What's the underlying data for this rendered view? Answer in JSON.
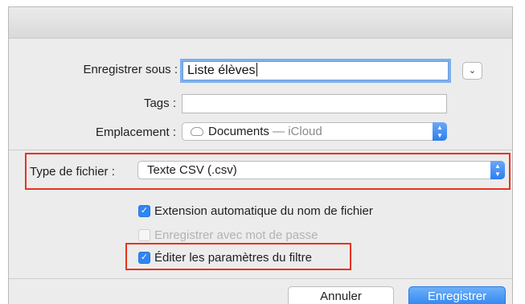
{
  "save_as": {
    "label": "Enregistrer sous :",
    "value": "Liste élèves"
  },
  "tags": {
    "label": "Tags :",
    "value": ""
  },
  "location": {
    "label": "Emplacement :",
    "folder": "Documents",
    "service": "— iCloud"
  },
  "file_type": {
    "label": "Type de fichier :",
    "value": "Texte CSV (.csv)"
  },
  "options": {
    "auto_extension": {
      "label": "Extension automatique du nom de fichier",
      "checked": true,
      "enabled": true
    },
    "password": {
      "label": "Enregistrer avec mot de passe",
      "checked": false,
      "enabled": false
    },
    "edit_filter": {
      "label": "Éditer les paramètres du filtre",
      "checked": true,
      "enabled": true
    }
  },
  "buttons": {
    "cancel": "Annuler",
    "save": "Enregistrer"
  },
  "colors": {
    "highlight": "#e8321e",
    "accent": "#2e86f5"
  }
}
